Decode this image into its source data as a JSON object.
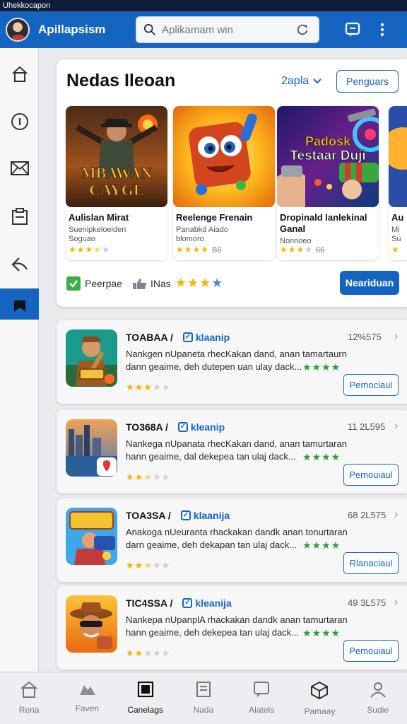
{
  "status_bar": {
    "text": "Uhekkocapon"
  },
  "app_bar": {
    "title": "Apillapsism",
    "search_placeholder": "Aplikamam win",
    "icons": {
      "search": "search-icon",
      "refresh": "refresh-icon",
      "chat": "chat-icon",
      "more": "more-vertical-icon"
    }
  },
  "sidebar": {
    "items": [
      {
        "icon": "home-icon"
      },
      {
        "icon": "info-icon"
      },
      {
        "icon": "mail-icon"
      },
      {
        "icon": "clipboard-icon"
      },
      {
        "icon": "back-arrow-icon"
      },
      {
        "icon": "bookmark-icon",
        "active": true
      }
    ]
  },
  "featured": {
    "title": "Nedas Ileoan",
    "filter_label": "2apla",
    "action_label": "Penguars",
    "cards": [
      {
        "image_text_1": "MBAWAN",
        "image_text_2": "CAYGE",
        "title": "Aulislan Mirat",
        "subtitle": "Suenipkeloeiden\nSoguao",
        "rating": 3.5,
        "score": ""
      },
      {
        "title": "Reelenge Frenain",
        "subtitle": "Panabkd Aiado\nblomoro",
        "rating": 4,
        "score": "B6"
      },
      {
        "image_text_1": "Padosk",
        "image_text_2": "Testaar Duji",
        "title": "Dropinald lanlekinal Ganal",
        "subtitle": "Nonnoeo",
        "rating": 3.5,
        "score": "66"
      },
      {
        "title": "Au",
        "subtitle": "Mi\nSu",
        "rating": 1,
        "score": ""
      }
    ],
    "footer": {
      "check_label": "Peerpae",
      "like_label": "INas",
      "rating": "3.5 blue",
      "cta_label": "Neariduan"
    }
  },
  "list": [
    {
      "title": "TOABAA /",
      "verified_label": "klaanip",
      "count": "12%575",
      "description": "Nankgen nUpaneta rhecKakan dand, anan tamartaurn dann geaime, deh dutepen uan ulay dack...",
      "stars": 3,
      "button": "Pemociaul",
      "icon": "game-icon-warrior"
    },
    {
      "title": "TO368A /",
      "verified_label": "kleanip",
      "count": "11 2L595",
      "description": "Nankega nUpanata rhecKakan dand, anan tamurtaran hann geaime, dal dekepea tan ulaj dack...",
      "stars": 2.5,
      "button": "Pemouiaul",
      "icon": "game-icon-city"
    },
    {
      "title": "TOA3SA /",
      "verified_label": "klaanija",
      "count": "68 2L575",
      "description": "Anakoga nUeuranta rhackakan dandk anan tonurtaran darn geaime, deh dekapan tan ulaj dack...",
      "stars": 2.5,
      "button": "Rlanaciaul",
      "icon": "game-icon-heroes"
    },
    {
      "title": "TIC4SSA /",
      "verified_label": "kleanija",
      "count": "49 3L575",
      "description": "Nankepa nUpanplA rhackakan dandk anan tamurtaran hann geaime, deh dekepea tan ulaj dack...",
      "stars": 2,
      "button": "Pemouiaul",
      "icon": "game-icon-cowboy"
    }
  ],
  "bottom_nav": [
    {
      "label": "Rena",
      "icon": "home-icon"
    },
    {
      "label": "Faven",
      "icon": "cloud-icon"
    },
    {
      "label": "Canelags",
      "icon": "window-icon",
      "active": true
    },
    {
      "label": "Nada",
      "icon": "document-icon"
    },
    {
      "label": "Alatels",
      "icon": "chat-icon"
    },
    {
      "label": "Pamaay",
      "icon": "package-icon"
    },
    {
      "label": "Sudie",
      "icon": "user-icon"
    }
  ],
  "colors": {
    "primary": "#1565c0",
    "star": "#f5b400",
    "green": "#2e9b3c",
    "background": "#e9ebef"
  }
}
